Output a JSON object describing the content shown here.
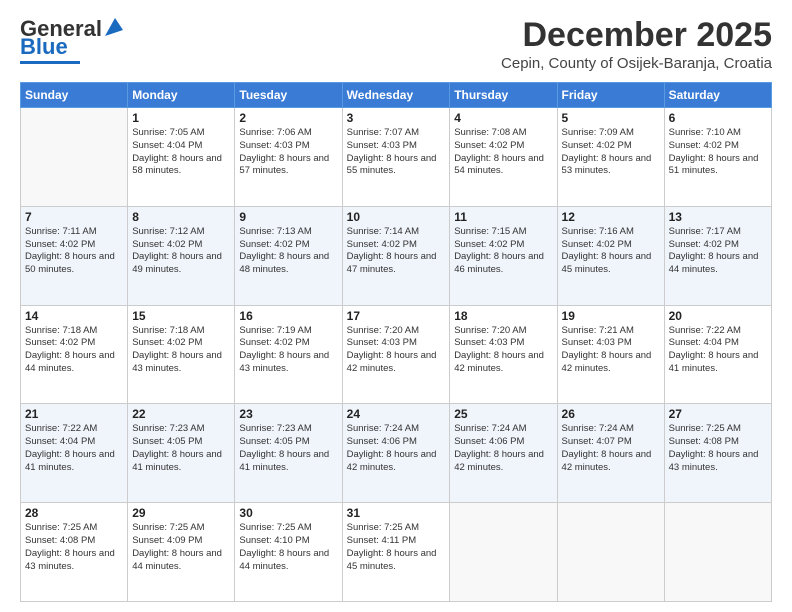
{
  "header": {
    "logo_general": "General",
    "logo_blue": "Blue",
    "month_title": "December 2025",
    "subtitle": "Cepin, County of Osijek-Baranja, Croatia"
  },
  "weekdays": [
    "Sunday",
    "Monday",
    "Tuesday",
    "Wednesday",
    "Thursday",
    "Friday",
    "Saturday"
  ],
  "weeks": [
    [
      {
        "day": "",
        "sunrise": "",
        "sunset": "",
        "daylight": ""
      },
      {
        "day": "1",
        "sunrise": "7:05 AM",
        "sunset": "4:04 PM",
        "daylight": "8 hours and 58 minutes."
      },
      {
        "day": "2",
        "sunrise": "7:06 AM",
        "sunset": "4:03 PM",
        "daylight": "8 hours and 57 minutes."
      },
      {
        "day": "3",
        "sunrise": "7:07 AM",
        "sunset": "4:03 PM",
        "daylight": "8 hours and 55 minutes."
      },
      {
        "day": "4",
        "sunrise": "7:08 AM",
        "sunset": "4:02 PM",
        "daylight": "8 hours and 54 minutes."
      },
      {
        "day": "5",
        "sunrise": "7:09 AM",
        "sunset": "4:02 PM",
        "daylight": "8 hours and 53 minutes."
      },
      {
        "day": "6",
        "sunrise": "7:10 AM",
        "sunset": "4:02 PM",
        "daylight": "8 hours and 51 minutes."
      }
    ],
    [
      {
        "day": "7",
        "sunrise": "7:11 AM",
        "sunset": "4:02 PM",
        "daylight": "8 hours and 50 minutes."
      },
      {
        "day": "8",
        "sunrise": "7:12 AM",
        "sunset": "4:02 PM",
        "daylight": "8 hours and 49 minutes."
      },
      {
        "day": "9",
        "sunrise": "7:13 AM",
        "sunset": "4:02 PM",
        "daylight": "8 hours and 48 minutes."
      },
      {
        "day": "10",
        "sunrise": "7:14 AM",
        "sunset": "4:02 PM",
        "daylight": "8 hours and 47 minutes."
      },
      {
        "day": "11",
        "sunrise": "7:15 AM",
        "sunset": "4:02 PM",
        "daylight": "8 hours and 46 minutes."
      },
      {
        "day": "12",
        "sunrise": "7:16 AM",
        "sunset": "4:02 PM",
        "daylight": "8 hours and 45 minutes."
      },
      {
        "day": "13",
        "sunrise": "7:17 AM",
        "sunset": "4:02 PM",
        "daylight": "8 hours and 44 minutes."
      }
    ],
    [
      {
        "day": "14",
        "sunrise": "7:18 AM",
        "sunset": "4:02 PM",
        "daylight": "8 hours and 44 minutes."
      },
      {
        "day": "15",
        "sunrise": "7:18 AM",
        "sunset": "4:02 PM",
        "daylight": "8 hours and 43 minutes."
      },
      {
        "day": "16",
        "sunrise": "7:19 AM",
        "sunset": "4:02 PM",
        "daylight": "8 hours and 43 minutes."
      },
      {
        "day": "17",
        "sunrise": "7:20 AM",
        "sunset": "4:03 PM",
        "daylight": "8 hours and 42 minutes."
      },
      {
        "day": "18",
        "sunrise": "7:20 AM",
        "sunset": "4:03 PM",
        "daylight": "8 hours and 42 minutes."
      },
      {
        "day": "19",
        "sunrise": "7:21 AM",
        "sunset": "4:03 PM",
        "daylight": "8 hours and 42 minutes."
      },
      {
        "day": "20",
        "sunrise": "7:22 AM",
        "sunset": "4:04 PM",
        "daylight": "8 hours and 41 minutes."
      }
    ],
    [
      {
        "day": "21",
        "sunrise": "7:22 AM",
        "sunset": "4:04 PM",
        "daylight": "8 hours and 41 minutes."
      },
      {
        "day": "22",
        "sunrise": "7:23 AM",
        "sunset": "4:05 PM",
        "daylight": "8 hours and 41 minutes."
      },
      {
        "day": "23",
        "sunrise": "7:23 AM",
        "sunset": "4:05 PM",
        "daylight": "8 hours and 41 minutes."
      },
      {
        "day": "24",
        "sunrise": "7:24 AM",
        "sunset": "4:06 PM",
        "daylight": "8 hours and 42 minutes."
      },
      {
        "day": "25",
        "sunrise": "7:24 AM",
        "sunset": "4:06 PM",
        "daylight": "8 hours and 42 minutes."
      },
      {
        "day": "26",
        "sunrise": "7:24 AM",
        "sunset": "4:07 PM",
        "daylight": "8 hours and 42 minutes."
      },
      {
        "day": "27",
        "sunrise": "7:25 AM",
        "sunset": "4:08 PM",
        "daylight": "8 hours and 43 minutes."
      }
    ],
    [
      {
        "day": "28",
        "sunrise": "7:25 AM",
        "sunset": "4:08 PM",
        "daylight": "8 hours and 43 minutes."
      },
      {
        "day": "29",
        "sunrise": "7:25 AM",
        "sunset": "4:09 PM",
        "daylight": "8 hours and 44 minutes."
      },
      {
        "day": "30",
        "sunrise": "7:25 AM",
        "sunset": "4:10 PM",
        "daylight": "8 hours and 44 minutes."
      },
      {
        "day": "31",
        "sunrise": "7:25 AM",
        "sunset": "4:11 PM",
        "daylight": "8 hours and 45 minutes."
      },
      {
        "day": "",
        "sunrise": "",
        "sunset": "",
        "daylight": ""
      },
      {
        "day": "",
        "sunrise": "",
        "sunset": "",
        "daylight": ""
      },
      {
        "day": "",
        "sunrise": "",
        "sunset": "",
        "daylight": ""
      }
    ]
  ],
  "labels": {
    "sunrise": "Sunrise:",
    "sunset": "Sunset:",
    "daylight": "Daylight:"
  }
}
